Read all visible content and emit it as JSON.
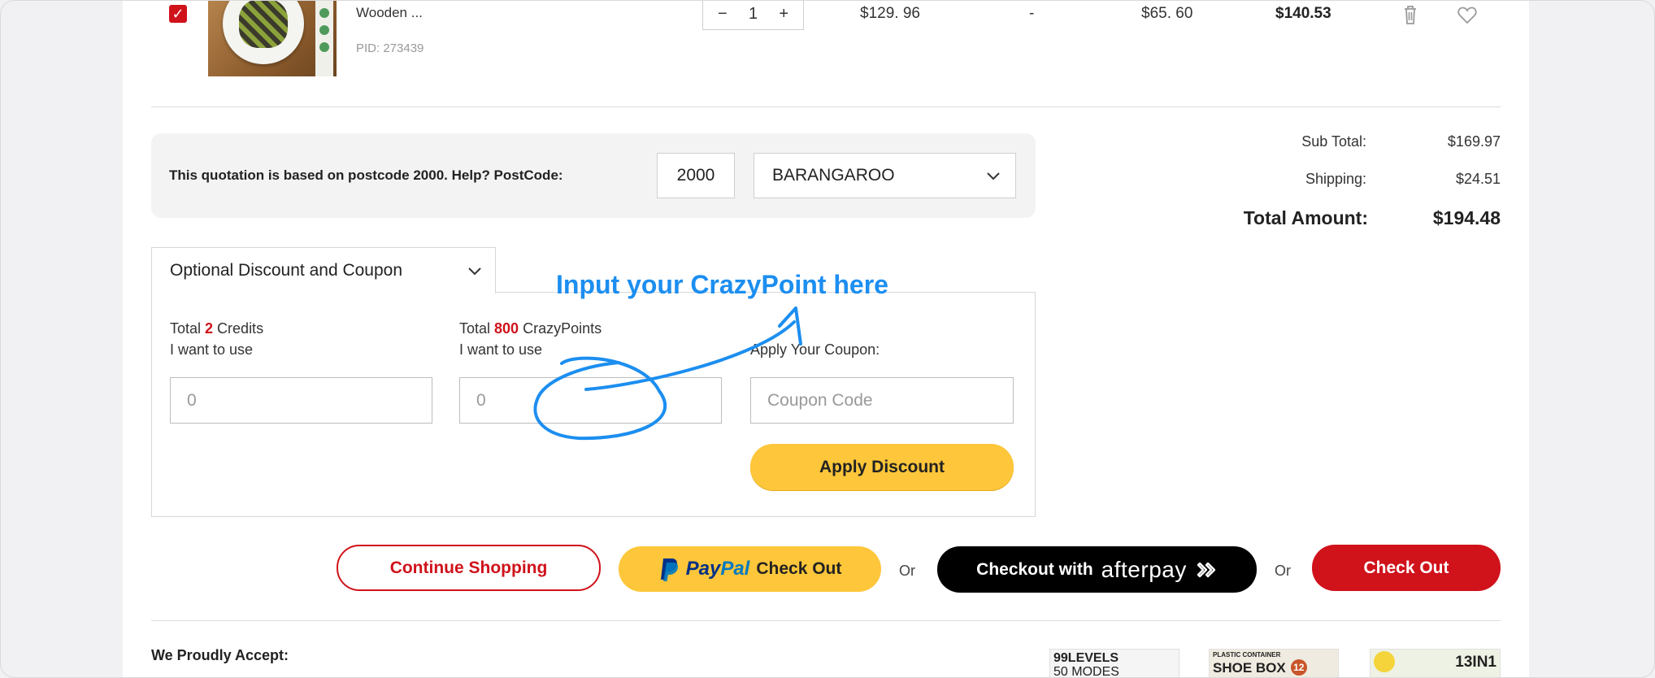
{
  "cart_item": {
    "name": "Wooden ...",
    "pid": "PID: 273439",
    "quantity": "1",
    "qty_minus": "−",
    "qty_plus": "+",
    "price": "$129. 96",
    "discount": "-",
    "saving": "$65. 60",
    "subtotal": "$140.53",
    "check_mark": "✓"
  },
  "postcode": {
    "text": "This quotation is based on postcode 2000. Help? PostCode:",
    "value": "2000",
    "suburb": "BARANGAROO"
  },
  "totals": {
    "sub_total_label": "Sub Total:",
    "sub_total": "$169.97",
    "shipping_label": "Shipping:",
    "shipping": "$24.51",
    "total_label": "Total Amount:",
    "total": "$194.48"
  },
  "discount": {
    "tab_label": "Optional Discount and Coupon",
    "credits_prefix": "Total ",
    "credits_count": "2",
    "credits_suffix": " Credits",
    "credits_line2": "I want to use",
    "credits_value": "0",
    "points_prefix": "Total ",
    "points_count": "800",
    "points_suffix": " CrazyPoints",
    "points_line2": "I want to use",
    "points_value": "0",
    "coupon_label": "Apply Your Coupon:",
    "coupon_placeholder": "Coupon Code",
    "apply_label": "Apply Discount"
  },
  "annotation": {
    "text": "Input your CrazyPoint here",
    "color": "#1c8ef0"
  },
  "checkout": {
    "continue_label": "Continue Shopping",
    "paypal_pay": "Pay",
    "paypal_pal": "Pal",
    "paypal_label": "Check Out",
    "or_1": "Or",
    "afterpay_prefix": "Checkout with",
    "afterpay_brand": "afterpay",
    "or_2": "Or",
    "checkout_label": "Check Out"
  },
  "accept": {
    "label": "We Proudly Accept:"
  },
  "promos": [
    {
      "line1": "99LEVELS",
      "line2": "50 MODES"
    },
    {
      "line1": "PLASTIC CONTAINER",
      "line2": "SHOE BOX",
      "badge": "12"
    },
    {
      "line1": "13IN1",
      "line2": ""
    }
  ],
  "colors": {
    "brand_red": "#d0121b",
    "accent_yellow": "#fec63a",
    "afterpay_black": "#000000"
  }
}
